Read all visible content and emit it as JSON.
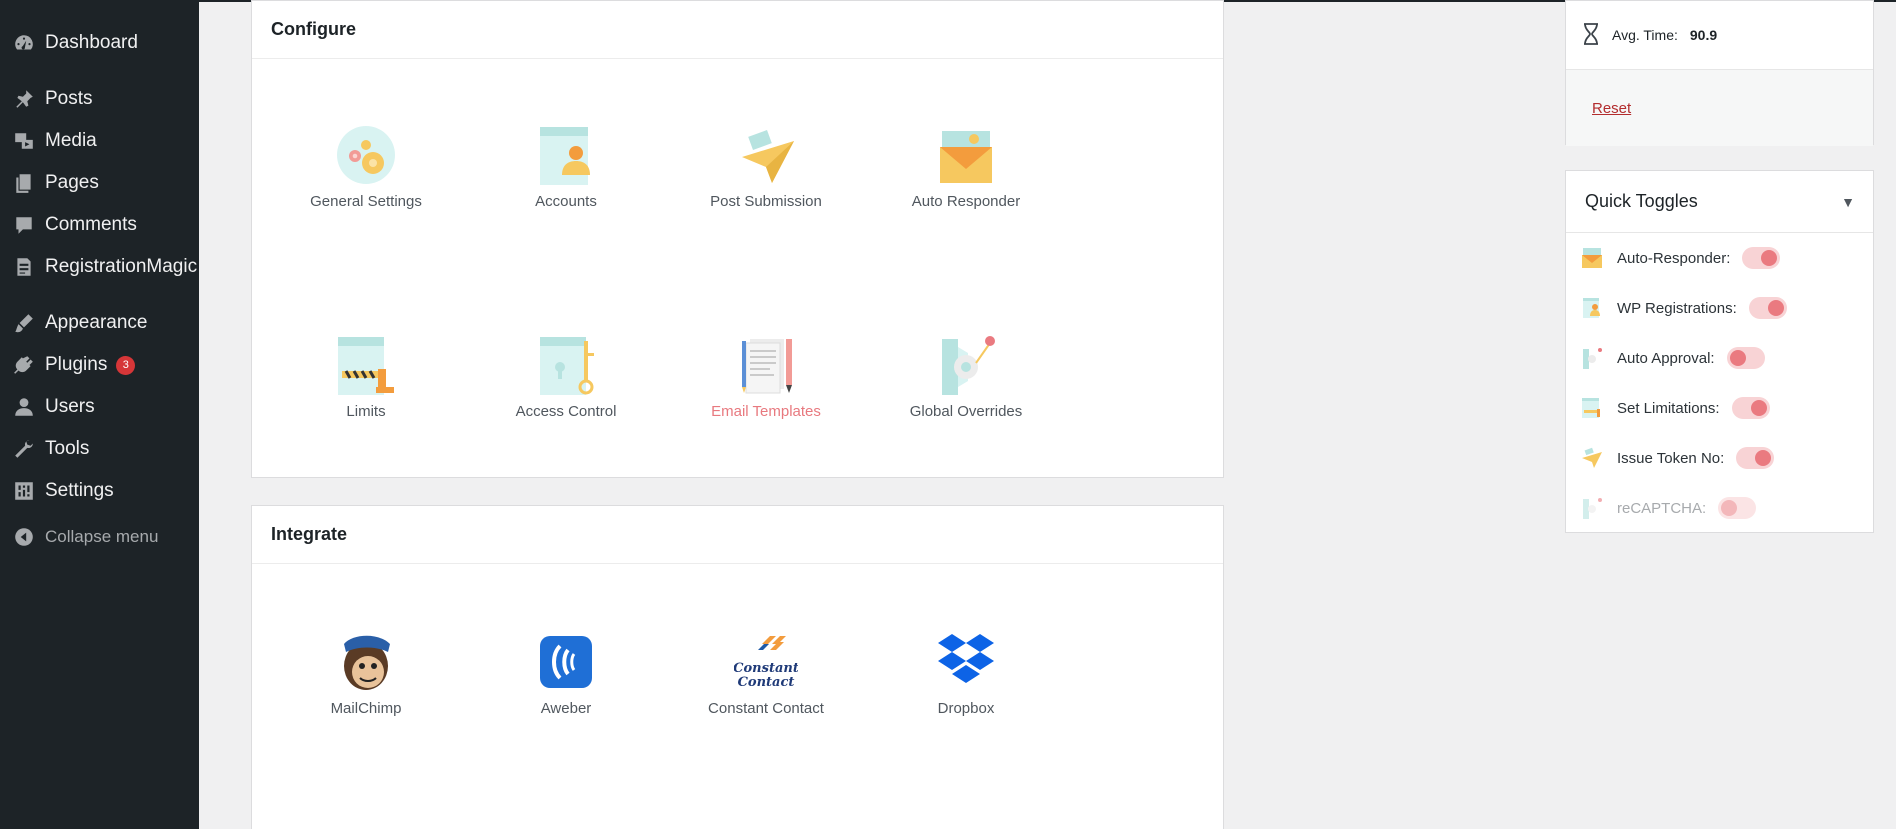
{
  "sidebar": {
    "items": [
      {
        "label": "Dashboard",
        "icon": "dashboard-icon"
      },
      {
        "label": "Posts",
        "icon": "pin-icon"
      },
      {
        "label": "Media",
        "icon": "media-icon"
      },
      {
        "label": "Pages",
        "icon": "pages-icon"
      },
      {
        "label": "Comments",
        "icon": "comment-icon"
      },
      {
        "label": "RegistrationMagic",
        "icon": "form-icon"
      },
      {
        "label": "Appearance",
        "icon": "brush-icon"
      },
      {
        "label": "Plugins",
        "icon": "plugin-icon",
        "badge": "3"
      },
      {
        "label": "Users",
        "icon": "user-icon"
      },
      {
        "label": "Tools",
        "icon": "wrench-icon"
      },
      {
        "label": "Settings",
        "icon": "settings-icon"
      }
    ],
    "collapse_label": "Collapse menu"
  },
  "configure": {
    "title": "Configure",
    "tiles": [
      {
        "label": "General Settings"
      },
      {
        "label": "Accounts"
      },
      {
        "label": "Post Submission"
      },
      {
        "label": "Auto Responder"
      },
      {
        "label": "Limits"
      },
      {
        "label": "Access Control"
      },
      {
        "label": "Email Templates"
      },
      {
        "label": "Global Overrides"
      }
    ]
  },
  "integrate": {
    "title": "Integrate",
    "tiles": [
      {
        "label": "MailChimp"
      },
      {
        "label": "Aweber"
      },
      {
        "label": "Constant Contact"
      },
      {
        "label": "Dropbox"
      }
    ]
  },
  "stats": {
    "avg_time_label": "Avg. Time:",
    "avg_time_value": "90.9",
    "reset_label": "Reset"
  },
  "quick_toggles": {
    "title": "Quick Toggles",
    "items": [
      {
        "label": "Auto-Responder:",
        "state": "on"
      },
      {
        "label": "WP Registrations:",
        "state": "on"
      },
      {
        "label": "Auto Approval:",
        "state": "off"
      },
      {
        "label": "Set Limitations:",
        "state": "on"
      },
      {
        "label": "Issue Token No:",
        "state": "on"
      },
      {
        "label": "reCAPTCHA:",
        "state": "off"
      }
    ]
  },
  "colors": {
    "sidebar_bg": "#1d2327",
    "accent": "#e8797f",
    "toggle_knob": "#ea7a80",
    "badge": "#d63638",
    "reset": "#b32d2e"
  }
}
